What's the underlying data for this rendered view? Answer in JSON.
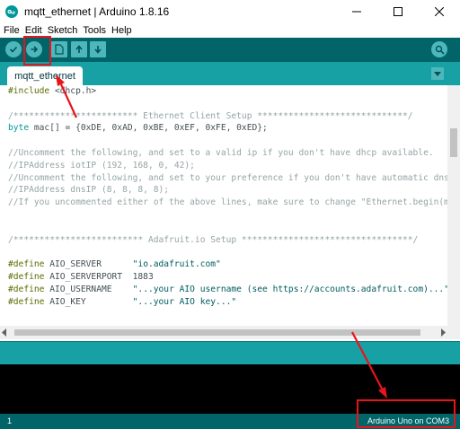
{
  "window": {
    "title": "mqtt_ethernet | Arduino 1.8.16"
  },
  "menu": {
    "items": [
      "File",
      "Edit",
      "Sketch",
      "Tools",
      "Help"
    ]
  },
  "toolbar": {
    "buttons": [
      "verify-icon",
      "upload-icon",
      "new-icon",
      "open-icon",
      "save-icon"
    ],
    "serial_monitor": "magnifier-icon"
  },
  "tabs": {
    "active": "mqtt_ethernet"
  },
  "editor": {
    "lines": [
      [
        {
          "t": "#include ",
          "c": "directive"
        },
        {
          "t": "<dhcp.h>",
          "c": "normal"
        }
      ],
      [
        {
          "t": "",
          "c": "normal"
        }
      ],
      [
        {
          "t": "/************************ Ethernet Client Setup *****************************/",
          "c": "comment"
        }
      ],
      [
        {
          "t": "byte",
          "c": "type"
        },
        {
          "t": " mac[] = {0xDE, 0xAD, 0xBE, 0xEF, 0xFE, 0xED};",
          "c": "normal"
        }
      ],
      [
        {
          "t": "",
          "c": "normal"
        }
      ],
      [
        {
          "t": "//Uncomment the following, and set to a valid ip if you don't have dhcp available.",
          "c": "comment"
        }
      ],
      [
        {
          "t": "//IPAddress iotIP (192, 168, 0, 42);",
          "c": "comment"
        }
      ],
      [
        {
          "t": "//Uncomment the following, and set to your preference if you don't have automatic dns.",
          "c": "comment"
        }
      ],
      [
        {
          "t": "//IPAddress dnsIP (8, 8, 8, 8);",
          "c": "comment"
        }
      ],
      [
        {
          "t": "//If you uncommented either of the above lines, make sure to change \"Ethernet.begin(mac",
          "c": "comment"
        }
      ],
      [
        {
          "t": "",
          "c": "normal"
        }
      ],
      [
        {
          "t": "",
          "c": "normal"
        }
      ],
      [
        {
          "t": "/************************* Adafruit.io Setup *********************************/",
          "c": "comment"
        }
      ],
      [
        {
          "t": "",
          "c": "normal"
        }
      ],
      [
        {
          "t": "#define",
          "c": "directive"
        },
        {
          "t": " AIO_SERVER      ",
          "c": "normal"
        },
        {
          "t": "\"io.adafruit.com\"",
          "c": "string"
        }
      ],
      [
        {
          "t": "#define",
          "c": "directive"
        },
        {
          "t": " AIO_SERVERPORT  1883",
          "c": "normal"
        }
      ],
      [
        {
          "t": "#define",
          "c": "directive"
        },
        {
          "t": " AIO_USERNAME    ",
          "c": "normal"
        },
        {
          "t": "\"...your AIO username (see https://accounts.adafruit.com)...\"",
          "c": "string"
        }
      ],
      [
        {
          "t": "#define",
          "c": "directive"
        },
        {
          "t": " AIO_KEY         ",
          "c": "normal"
        },
        {
          "t": "\"...your AIO key...\"",
          "c": "string"
        }
      ]
    ]
  },
  "status": {
    "line_number": "1",
    "board": "Arduino Uno on COM3"
  },
  "colors": {
    "toolbar": "#006468",
    "tabbar": "#17a1a5",
    "button": "#4db7bb",
    "annotation": "#e8141c"
  }
}
